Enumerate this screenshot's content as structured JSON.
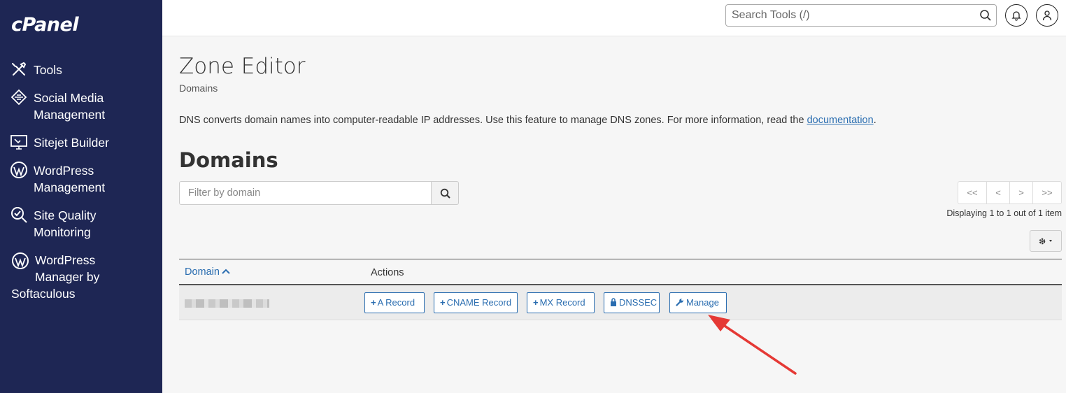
{
  "sidebar": {
    "logo": "cPanel",
    "items": [
      {
        "label_1": "Tools",
        "icon": "tools-icon"
      },
      {
        "label_1": "Social Media",
        "label_2": "Management",
        "icon": "social-media-icon"
      },
      {
        "label_1": "Sitejet Builder",
        "icon": "sitejet-icon"
      },
      {
        "label_1": "WordPress",
        "label_2": "Management",
        "icon": "wordpress-icon"
      },
      {
        "label_1": "Site Quality",
        "label_2": "Monitoring",
        "icon": "site-quality-icon"
      },
      {
        "label_1": "WordPress",
        "label_2": "Manager by",
        "label_3": "Softaculous",
        "icon": "wordpress-icon"
      }
    ]
  },
  "header": {
    "search_placeholder": "Search Tools (/)"
  },
  "main": {
    "title": "Zone Editor",
    "breadcrumb": "Domains",
    "description": "DNS converts domain names into computer-readable IP addresses. Use this feature to manage DNS zones. For more information, read the ",
    "doc_link": "documentation",
    "description_end": ".",
    "section_title": "Domains",
    "filter_placeholder": "Filter by domain",
    "pager": [
      "<<",
      "<",
      ">",
      ">>"
    ],
    "displaying": "Displaying 1 to 1 out of 1 item",
    "table": {
      "col_domain": "Domain",
      "col_actions": "Actions",
      "rows": [
        {
          "domain_blurred": true,
          "actions": [
            {
              "prefix": "+",
              "label": "A Record"
            },
            {
              "prefix": "+",
              "label": "CNAME Record"
            },
            {
              "prefix": "+",
              "label": "MX Record"
            },
            {
              "prefix": "lock",
              "label": "DNSSEC"
            },
            {
              "prefix": "wrench",
              "label": "Manage"
            }
          ]
        }
      ]
    }
  },
  "colors": {
    "sidebar_bg": "#1e2654",
    "link": "#2a6db0",
    "annotation_arrow": "#e53935"
  }
}
